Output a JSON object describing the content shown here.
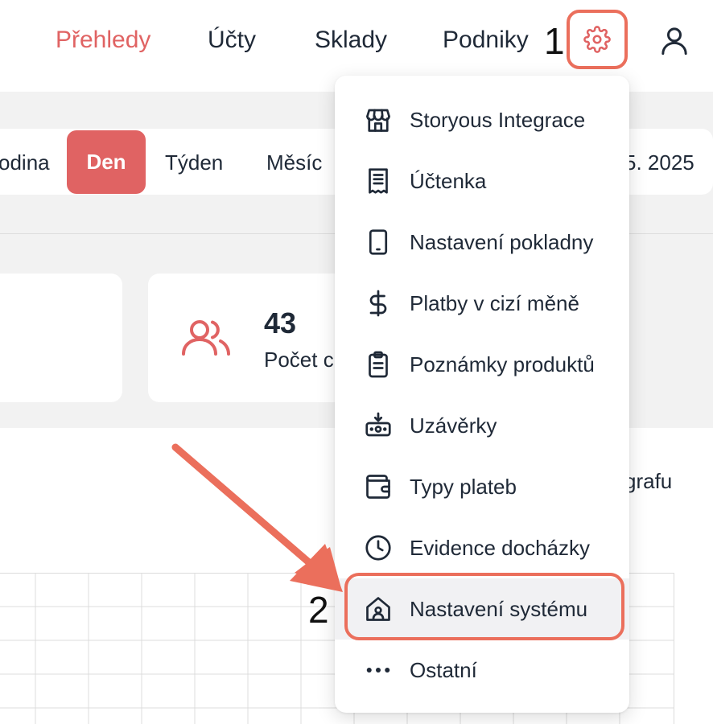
{
  "header": {
    "nav": [
      {
        "label": "Přehledy",
        "active": true
      },
      {
        "label": "Účty",
        "active": false
      },
      {
        "label": "Sklady",
        "active": false
      },
      {
        "label": "Podniky",
        "active": false
      }
    ],
    "settings_icon": "gear-icon",
    "user_icon": "user-icon",
    "accent_color": "#e06363"
  },
  "annotations": {
    "step1": "1",
    "step2": "2",
    "color": "#eb6f5c"
  },
  "period": {
    "items": [
      "odina",
      "Den",
      "Týden",
      "Měsíc"
    ],
    "active": "Den",
    "date_fragment": "5. 2025"
  },
  "stats": {
    "card2_value": "43",
    "card2_label": "Počet c",
    "card2_icon": "users-icon"
  },
  "chart": {
    "label_fragment": "grafu"
  },
  "menu": {
    "items": [
      {
        "label": "Storyous Integrace",
        "icon": "store-icon"
      },
      {
        "label": "Účtenka",
        "icon": "receipt-icon"
      },
      {
        "label": "Nastavení pokladny",
        "icon": "tablet-icon"
      },
      {
        "label": "Platby v cizí měně",
        "icon": "dollar-icon"
      },
      {
        "label": "Poznámky produktů",
        "icon": "clipboard-icon"
      },
      {
        "label": "Uzávěrky",
        "icon": "cash-register-icon"
      },
      {
        "label": "Typy plateb",
        "icon": "wallet-icon"
      },
      {
        "label": "Evidence docházky",
        "icon": "clock-icon"
      },
      {
        "label": "Nastavení systému",
        "icon": "home-settings-icon",
        "highlighted": true
      },
      {
        "label": "Ostatní",
        "icon": "more-icon"
      }
    ]
  }
}
